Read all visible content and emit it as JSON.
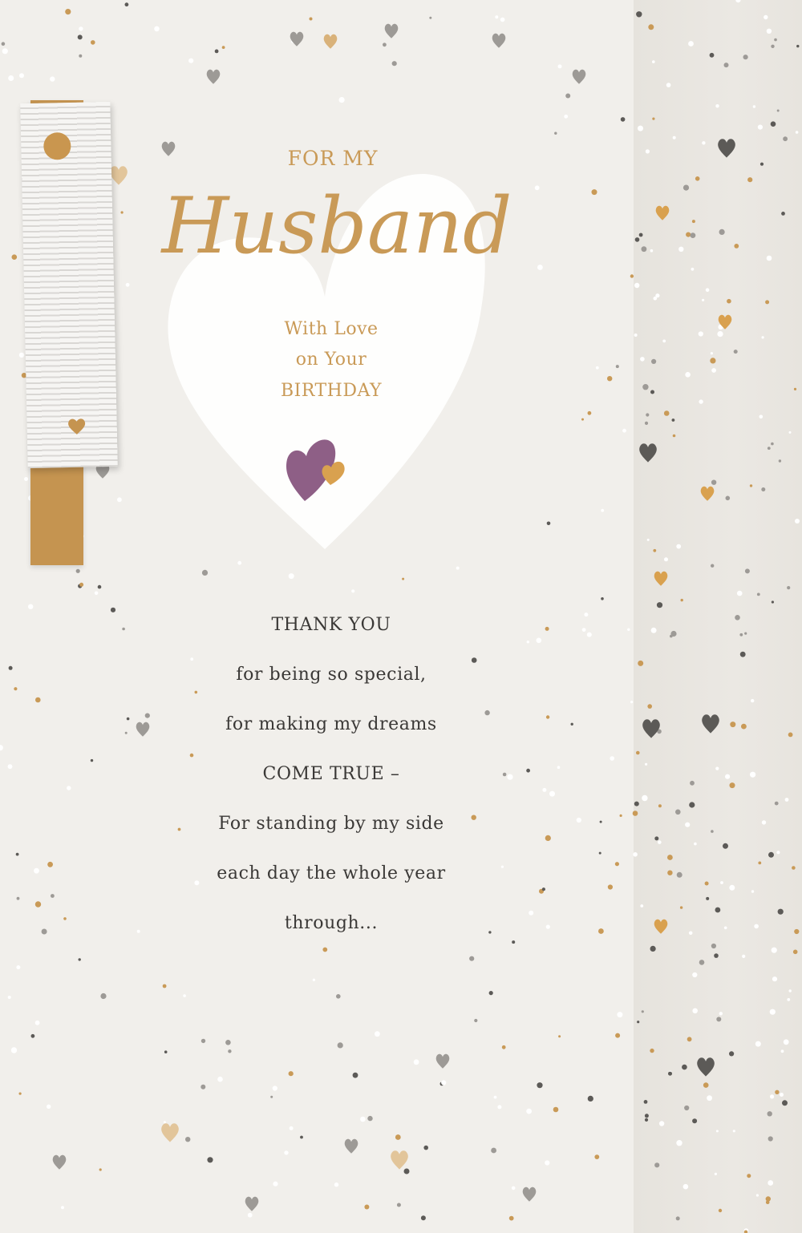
{
  "card": {
    "title_top": "FOR MY",
    "title_script": "Husband",
    "subtitle_lines": [
      "With Love",
      "on Your",
      "BIRTHDAY"
    ],
    "verse_lines": [
      "THANK YOU",
      "for being so special,",
      "for making my dreams",
      "COME TRUE –",
      "For standing by my side",
      "each day the whole year",
      "through..."
    ]
  },
  "colors": {
    "gold": "#c99a57",
    "plum": "#8e5f86",
    "charcoal": "#5c5a57",
    "grey": "#9d9a96",
    "background": "#f1efeb"
  },
  "decorations": {
    "large_heart": "heart-icon",
    "small_hearts": "double-heart-icon",
    "ribbon": "ribbon-tag"
  }
}
